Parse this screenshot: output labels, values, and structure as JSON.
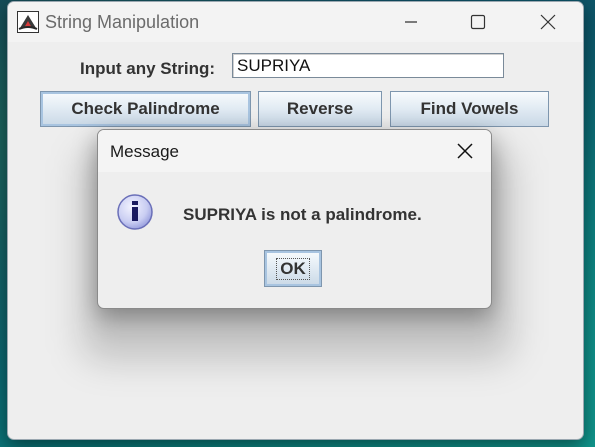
{
  "window": {
    "title": "String Manipulation",
    "controls": {
      "minimize_icon": "minimize-icon",
      "maximize_icon": "maximize-icon",
      "close_icon": "close-icon"
    }
  },
  "form": {
    "input_label": "Input any String:",
    "input_value": "SUPRIYA"
  },
  "buttons": {
    "check_palindrome": "Check Palindrome",
    "reverse": "Reverse",
    "find_vowels": "Find Vowels"
  },
  "dialog": {
    "title": "Message",
    "message": "SUPRIYA is not a palindrome.",
    "ok_label": "OK",
    "icon": "info-icon"
  },
  "colors": {
    "button_border": "#7e96ae",
    "button_focus_ring": "#a8c4e0",
    "window_bg": "#eeeeee",
    "info_icon_fill": "#c9cdf2"
  }
}
